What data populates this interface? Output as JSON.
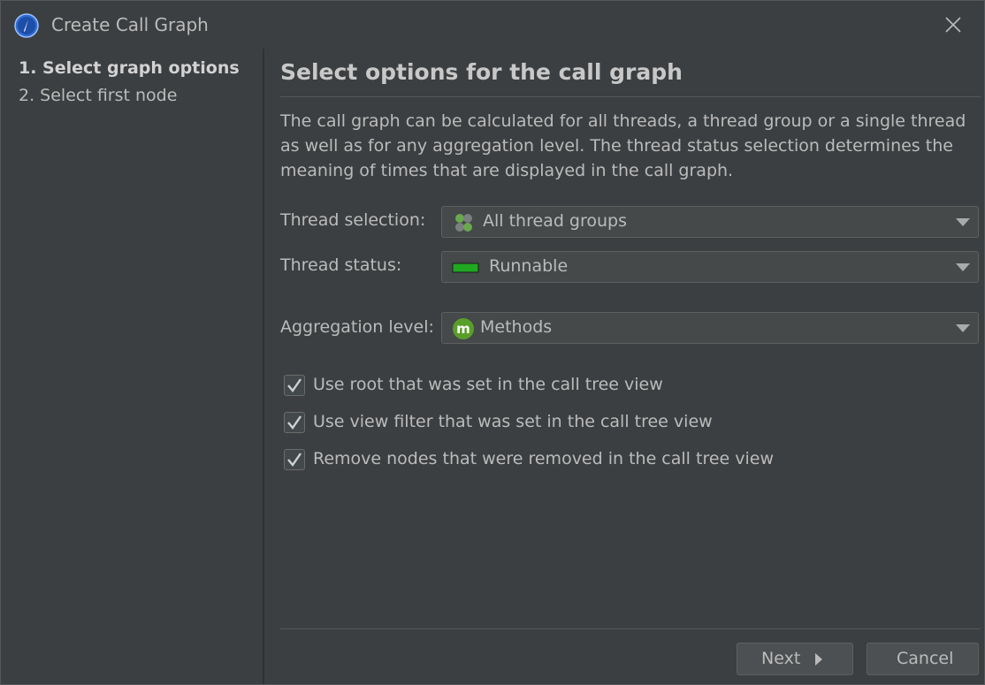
{
  "window": {
    "title": "Create Call Graph"
  },
  "steps": [
    {
      "label": "1. Select graph options",
      "active": true
    },
    {
      "label": "2. Select first node",
      "active": false
    }
  ],
  "main": {
    "heading": "Select options for the call graph",
    "description": "The call graph can be calculated for all threads, a thread group or a single thread as well as for any aggregation level. The thread status selection determines the meaning of times that are displayed in the call graph.",
    "fields": [
      {
        "label": "Thread selection:",
        "value": "All thread groups",
        "icon": "thread-groups-icon"
      },
      {
        "label": "Thread status:",
        "value": "Runnable",
        "icon": "runnable-status-icon"
      },
      {
        "label": "Aggregation level:",
        "value": "Methods",
        "icon": "methods-icon"
      }
    ],
    "checkboxes": [
      {
        "label": "Use root that was set in the call tree view",
        "checked": true
      },
      {
        "label": "Use view filter that was set in the call tree view",
        "checked": true
      },
      {
        "label": "Remove nodes that were removed in the call tree view",
        "checked": true
      }
    ]
  },
  "buttons": {
    "next": "Next",
    "cancel": "Cancel"
  },
  "colors": {
    "background": "#3c3f41",
    "runnable": "#21a821",
    "methods": "#5a9e2a",
    "app_icon": "#2f6bd1"
  }
}
